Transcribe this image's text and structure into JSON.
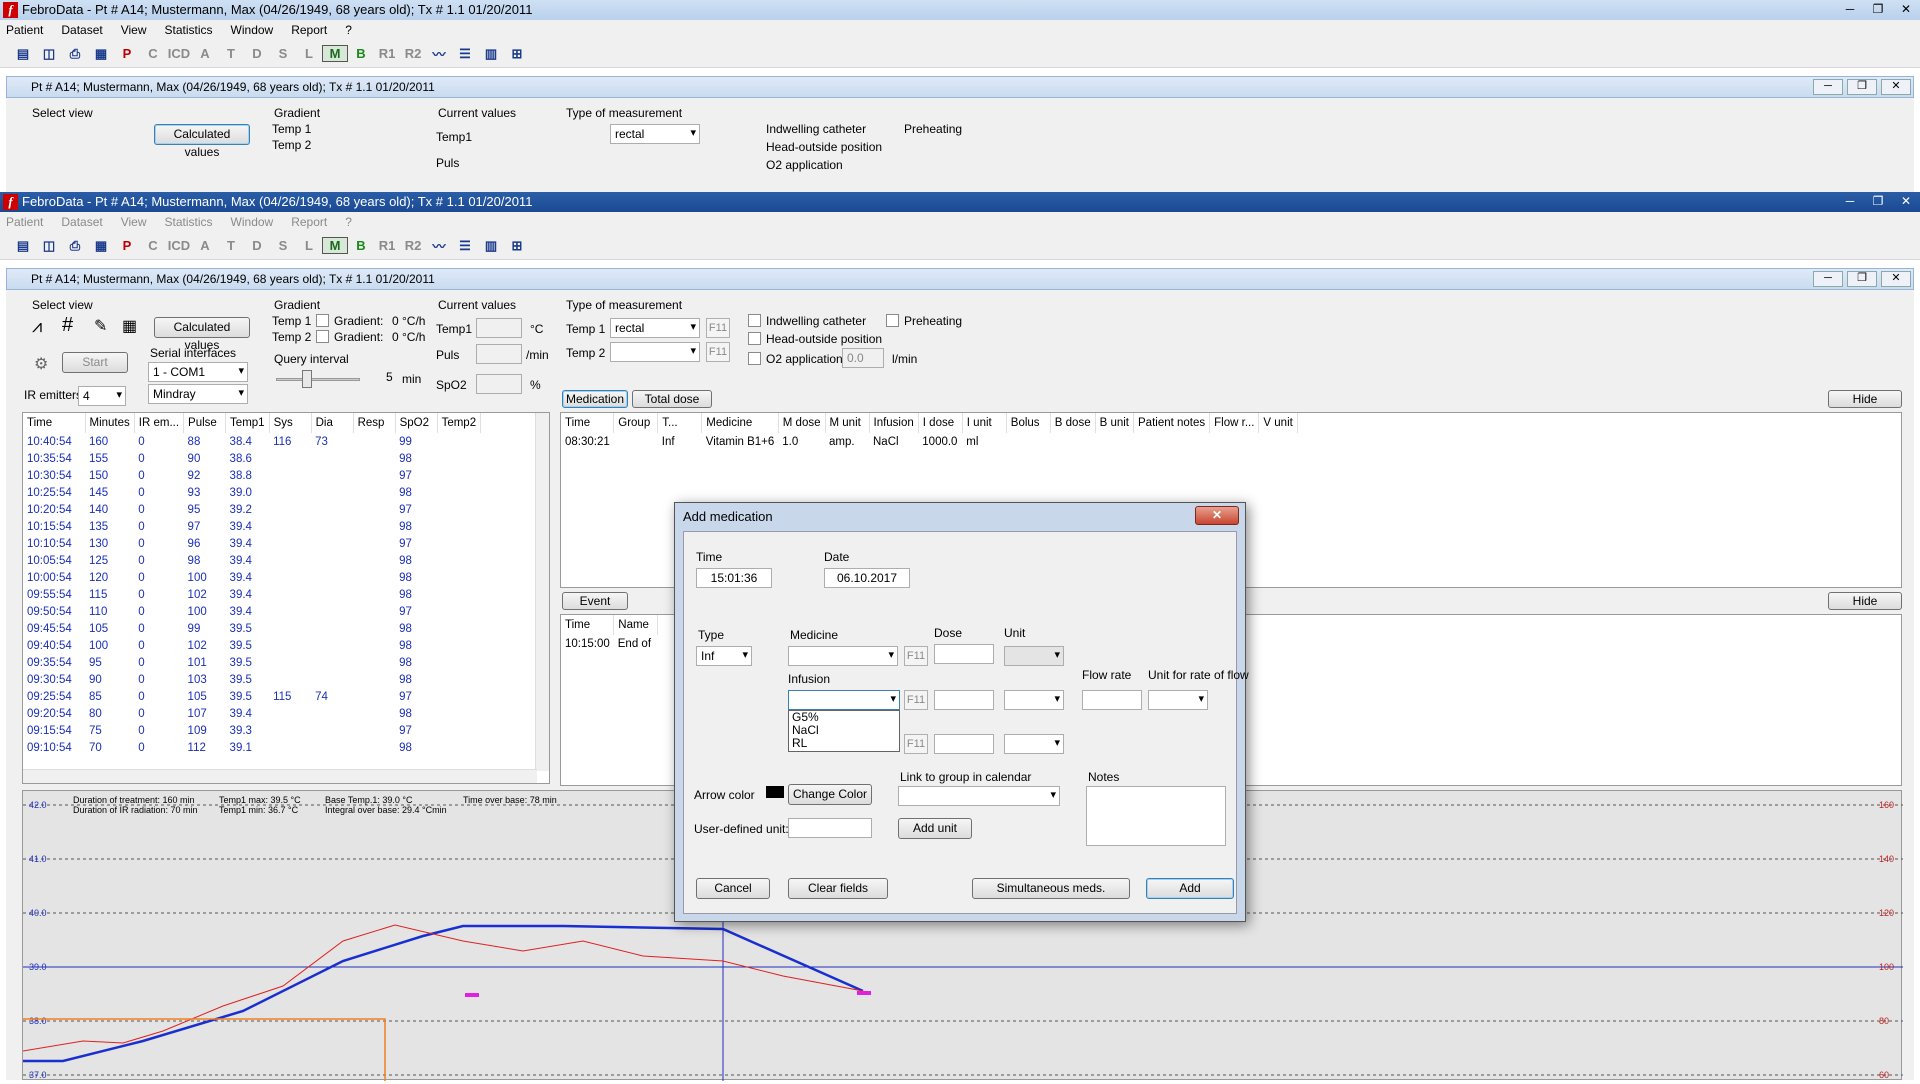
{
  "window_title": "FebroData - Pt # A14; Mustermann, Max (04/26/1949, 68 years old); Tx # 1.1   01/20/2011",
  "menu": [
    "Patient",
    "Dataset",
    "View",
    "Statistics",
    "Window",
    "Report",
    "?"
  ],
  "toolbar_letters": [
    "P",
    "C",
    "ICD",
    "A",
    "T",
    "D",
    "S",
    "L",
    "M",
    "B",
    "R1",
    "R2"
  ],
  "child_title": "Pt # A14; Mustermann, Max (04/26/1949, 68 years old); Tx # 1.1   01/20/2011",
  "select_view": {
    "label": "Select view",
    "calc_btn": "Calculated values"
  },
  "start_btn": "Start",
  "serial": {
    "label": "Serial interfaces",
    "value": "1 - COM1",
    "device": "Mindray"
  },
  "ir_emitters": {
    "label": "IR emitters",
    "value": "4"
  },
  "gradient": {
    "label": "Gradient",
    "t1": "Temp 1",
    "t2": "Temp 2",
    "g": "Gradient:",
    "v1": "0 °C/h",
    "v2": "0 °C/h"
  },
  "query": {
    "label": "Query interval",
    "value": "5",
    "unit": "min"
  },
  "current": {
    "label": "Current values",
    "temp1": "Temp1",
    "temp1_unit": "°C",
    "puls": "Puls",
    "puls_unit": "/min",
    "spo2": "SpO2",
    "spo2_unit": "%"
  },
  "measurement": {
    "label": "Type of measurement",
    "t1": "Temp 1",
    "t1_val": "rectal",
    "t2": "Temp 2",
    "f11": "F11"
  },
  "options": {
    "catheter": "Indwelling catheter",
    "preheating": "Preheating",
    "head": "Head-outside position",
    "o2": "O2 application",
    "o2_val": "0.0",
    "o2_unit": "l/min"
  },
  "tabs": {
    "medication": "Medication",
    "total": "Total dose",
    "hide": "Hide",
    "event": "Event"
  },
  "vitals": {
    "headers": [
      "Time",
      "Minutes",
      "IR em...",
      "Pulse",
      "Temp1",
      "Sys",
      "Dia",
      "Resp",
      "SpO2",
      "Temp2"
    ],
    "rows": [
      [
        "10:40:54",
        "160",
        "0",
        "88",
        "38.4",
        "116",
        "73",
        "",
        "99",
        ""
      ],
      [
        "10:35:54",
        "155",
        "0",
        "90",
        "38.6",
        "",
        "",
        "",
        "98",
        ""
      ],
      [
        "10:30:54",
        "150",
        "0",
        "92",
        "38.8",
        "",
        "",
        "",
        "97",
        ""
      ],
      [
        "10:25:54",
        "145",
        "0",
        "93",
        "39.0",
        "",
        "",
        "",
        "98",
        ""
      ],
      [
        "10:20:54",
        "140",
        "0",
        "95",
        "39.2",
        "",
        "",
        "",
        "97",
        ""
      ],
      [
        "10:15:54",
        "135",
        "0",
        "97",
        "39.4",
        "",
        "",
        "",
        "98",
        ""
      ],
      [
        "10:10:54",
        "130",
        "0",
        "96",
        "39.4",
        "",
        "",
        "",
        "97",
        ""
      ],
      [
        "10:05:54",
        "125",
        "0",
        "98",
        "39.4",
        "",
        "",
        "",
        "98",
        ""
      ],
      [
        "10:00:54",
        "120",
        "0",
        "100",
        "39.4",
        "",
        "",
        "",
        "98",
        ""
      ],
      [
        "09:55:54",
        "115",
        "0",
        "102",
        "39.4",
        "",
        "",
        "",
        "98",
        ""
      ],
      [
        "09:50:54",
        "110",
        "0",
        "100",
        "39.4",
        "",
        "",
        "",
        "97",
        ""
      ],
      [
        "09:45:54",
        "105",
        "0",
        "99",
        "39.5",
        "",
        "",
        "",
        "98",
        ""
      ],
      [
        "09:40:54",
        "100",
        "0",
        "102",
        "39.5",
        "",
        "",
        "",
        "98",
        ""
      ],
      [
        "09:35:54",
        "95",
        "0",
        "101",
        "39.5",
        "",
        "",
        "",
        "98",
        ""
      ],
      [
        "09:30:54",
        "90",
        "0",
        "103",
        "39.5",
        "",
        "",
        "",
        "98",
        ""
      ],
      [
        "09:25:54",
        "85",
        "0",
        "105",
        "39.5",
        "115",
        "74",
        "",
        "97",
        ""
      ],
      [
        "09:20:54",
        "80",
        "0",
        "107",
        "39.4",
        "",
        "",
        "",
        "98",
        ""
      ],
      [
        "09:15:54",
        "75",
        "0",
        "109",
        "39.3",
        "",
        "",
        "",
        "97",
        ""
      ],
      [
        "09:10:54",
        "70",
        "0",
        "112",
        "39.1",
        "",
        "",
        "",
        "98",
        ""
      ]
    ]
  },
  "medication_table": {
    "headers": [
      "Time",
      "Group",
      "T...",
      "Medicine",
      "M dose",
      "M unit",
      "Infusion",
      "I dose",
      "I unit",
      "Bolus",
      "B dose",
      "B unit",
      "Patient notes",
      "Flow r...",
      "V unit"
    ],
    "rows": [
      [
        "08:30:21",
        "",
        "Inf",
        "Vitamin B1+6",
        "1.0",
        "amp.",
        "NaCl",
        "1000.0",
        "ml",
        "",
        "",
        "",
        "",
        "",
        ""
      ]
    ]
  },
  "event_table": {
    "headers": [
      "Time",
      "Name"
    ],
    "rows": [
      [
        "10:15:00",
        "End of"
      ]
    ]
  },
  "chart_info": {
    "line1": "Duration of treatment: 160 min",
    "line2": "Duration of IR radiation: 70 min",
    "line3": "Temp1 max: 39.5 °C",
    "line4": "Temp1 min: 36.7 °C",
    "line5": "Base Temp.1: 39.0 °C",
    "line6": "Integral over base: 29.4 °Cmin",
    "line7": "Time over base: 78 min"
  },
  "chart_data": {
    "type": "line",
    "left_ticks": [
      "42.0",
      "41.0",
      "40.0",
      "39.0",
      "38.0",
      "37.0"
    ],
    "right_ticks": [
      "160",
      "140",
      "120",
      "100",
      "80",
      "60"
    ]
  },
  "dialog": {
    "title": "Add medication",
    "time_label": "Time",
    "time_value": "15:01:36",
    "date_label": "Date",
    "date_value": "06.10.2017",
    "type_label": "Type",
    "type_value": "Inf",
    "medicine_label": "Medicine",
    "dose_label": "Dose",
    "unit_label": "Unit",
    "infusion_label": "Infusion",
    "flow_label": "Flow rate",
    "flow_unit_label": "Unit for rate of flow",
    "f11": "F11",
    "infusion_options": [
      "G5%",
      "NaCl",
      "RL"
    ],
    "arrow_label": "Arrow color",
    "change_color": "Change Color",
    "link_label": "Link to group in calendar",
    "notes_label": "Notes",
    "user_unit_label": "User-defined unit:",
    "add_unit": "Add unit",
    "cancel": "Cancel",
    "clear": "Clear fields",
    "simultaneous": "Simultaneous meds.",
    "add": "Add"
  }
}
